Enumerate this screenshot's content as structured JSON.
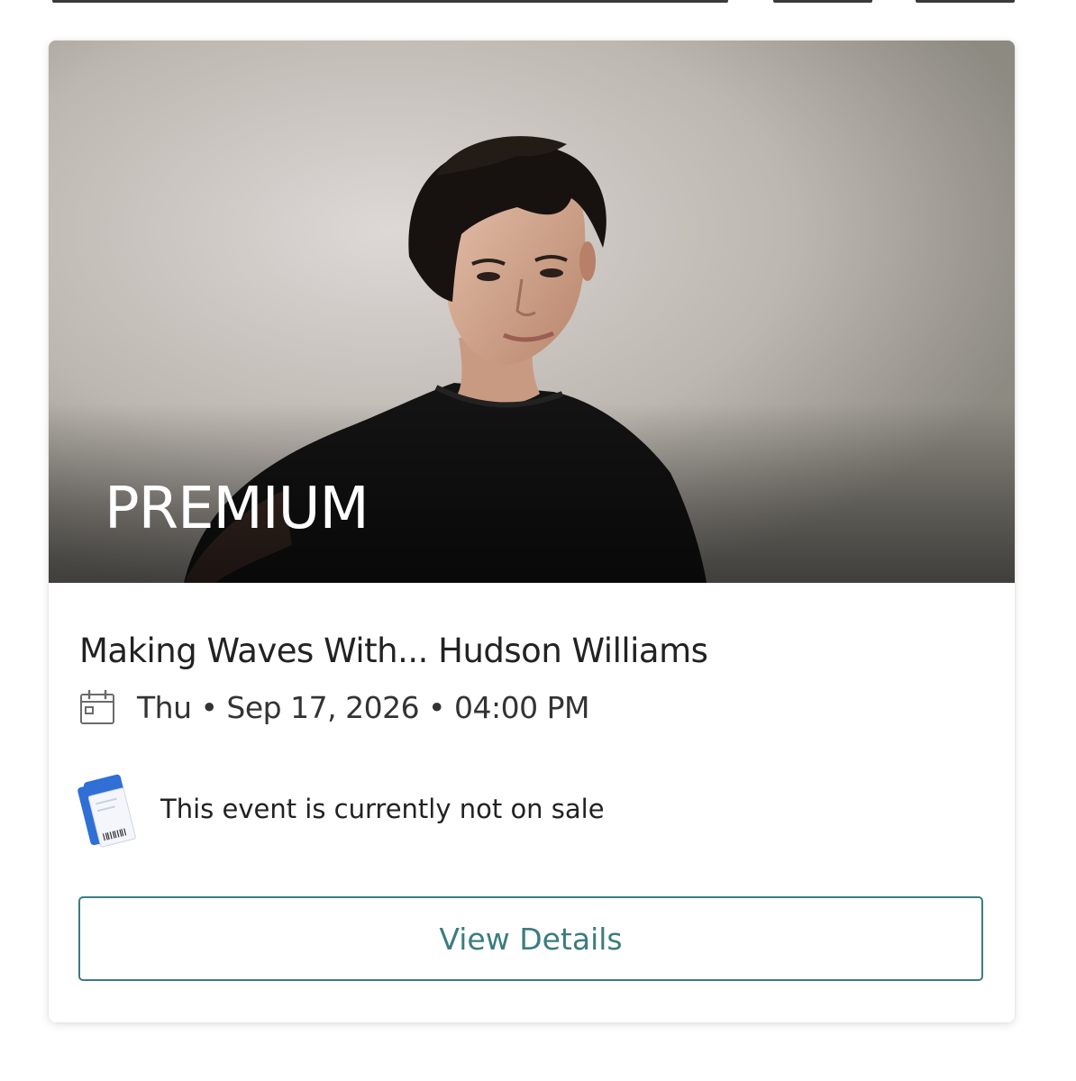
{
  "card": {
    "badge": "PREMIUM",
    "title": "Making Waves With... Hudson Williams",
    "date_text": "Thu • Sep 17, 2026 • 04:00 PM",
    "sale_status": "This event is currently not on sale",
    "view_details_label": "View Details"
  },
  "icons": {
    "calendar": "calendar-icon",
    "ticket": "ticket-icon"
  },
  "colors": {
    "accent": "#3b7c80",
    "ticket_blue": "#2f6fd6",
    "title_text": "#222222"
  }
}
